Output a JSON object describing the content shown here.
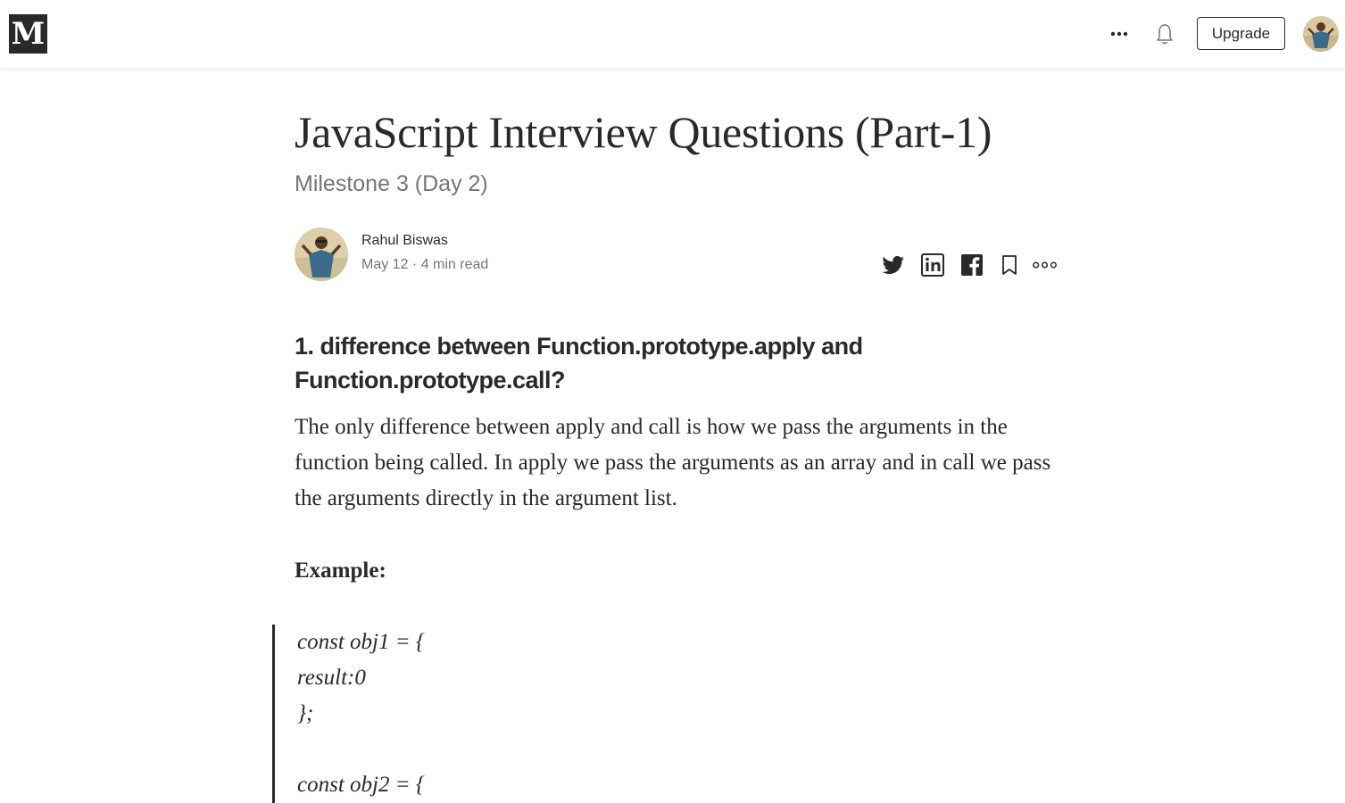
{
  "nav": {
    "logo": "M",
    "upgrade_label": "Upgrade",
    "icons": [
      "more-icon",
      "bell-icon"
    ]
  },
  "article": {
    "title": "JavaScript Interview Questions (Part-1)",
    "subtitle": "Milestone 3 (Day 2)",
    "author": {
      "name": "Rahul Biswas",
      "date": "May 12",
      "separator": "·",
      "read_time": "4 min read"
    },
    "share_icons": [
      "twitter-icon",
      "linkedin-icon",
      "facebook-icon",
      "bookmark-icon",
      "more-options-icon"
    ],
    "heading": "1. difference between Function.prototype.apply and Function.prototype.call?",
    "paragraph": "The only difference between apply and call is how we pass the arguments in the function being called. In apply we pass the arguments as an array and in call we pass the arguments directly in the argument list.",
    "example_label": "Example:",
    "code_lines": [
      "const obj1 = {",
      "result:0",
      "};",
      "",
      "const obj2 = {"
    ]
  },
  "colors": {
    "text": "#292929",
    "muted": "#757575",
    "logo_bg": "#292929"
  }
}
